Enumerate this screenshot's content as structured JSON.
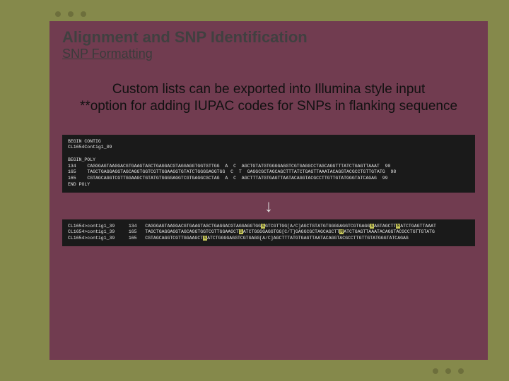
{
  "title": "Alignment and SNP Identification",
  "subtitle": "SNP Formatting",
  "body_line1": "Custom lists can be exported into Illumina style input",
  "body_line2": "**option for adding IUPAC codes for SNPs in flanking sequence",
  "terminal1": {
    "header1": "BEGIN CONTIG",
    "header2": "CL1654Contig1_09",
    "section": "BEGIN_POLY",
    "rows": [
      {
        "pos": "134",
        "left": "CAGGGAGTAAGGACGTGAAGTAGCTGAGGACGTAGGAGGTGGTGTTGG",
        "a1": "A",
        "a2": "C",
        "right": "AGCTGTATGTGGGGAGGTCGTGAGGCCTAGCAGGTTTATCTGAGTTAAAT",
        "score": "90"
      },
      {
        "pos": "165",
        "left": "TAGCTGAGGAGGTAGCAGGTGGTCGTTGGAAGGTGTATCTGGGGAGGTGG",
        "a1": "C",
        "a2": "T",
        "right": "GAGGCGCTAGCAGCTTTATCTGAGTTAAATACAGGTACGCCTGTTGTATG",
        "score": "98"
      },
      {
        "pos": "165",
        "left": "CGTAGCAGGTCGTTGGAAGCTGTATGTGGGGAGGTCGTGAGGCGCTAG",
        "a1": "A",
        "a2": "C",
        "right": "AGCTTTATGTGAGTTAATACAGGTACGCCTTGTTGTATGGGTATCAGAG",
        "score": "99"
      }
    ],
    "footer": "END POLY"
  },
  "terminal2": {
    "rows": [
      {
        "id": "CL1654>contig1_39",
        "pos": "134",
        "seq_pre": "CAGGGAGTAAGGACGTGAAGTAGCTGAGGACGTAGGAGGTGG",
        "hl1": "S",
        "mid1": "GTCGTTGG[A/C]AGCTGTATGTGGGGAGGTCGTGAGG",
        "hl2": "S",
        "mid2": "AGTAGCTT",
        "hl3": "M",
        "tail": "ATCTGAGTTAAAT"
      },
      {
        "id": "CL1654>contig1_39",
        "pos": "165",
        "seq_pre": "TAGCTGAGGAGGTAGCAGGTGGTCGTTGGAAGCT",
        "hl1": "S",
        "mid1": "ATCTGGGGAGGTGG[C/T]GAGGCGCTAGCAGCTT",
        "hl2": "M",
        "mid2": "ATCTGAGTTAAATACAGGTACGCCTGTTGTATG",
        "hl3": "",
        "tail": ""
      },
      {
        "id": "CL1654>contig1_39",
        "pos": "165",
        "seq_pre": "CGTAGCAGGTCGTTGGAAGCT",
        "hl1": "S",
        "mid1": "ATCTGGGGAGGTCGTGAGG[A/C]AGCTTTATGTGAGTTAATACAGGTACGCCTTGTTGTATGGGTATCAGAG",
        "hl2": "",
        "mid2": "",
        "hl3": "",
        "tail": ""
      }
    ]
  }
}
